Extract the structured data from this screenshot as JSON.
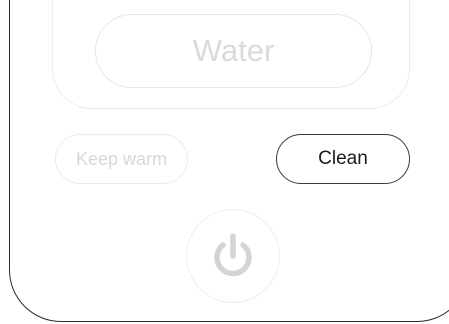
{
  "controls": {
    "water_label": "Water",
    "keep_warm_label": "Keep warm",
    "clean_label": "Clean"
  },
  "icons": {
    "power": "power-icon"
  },
  "colors": {
    "active_border": "#3a3a3a",
    "active_text": "#1a1a1a",
    "inactive_text": "#d8d8d8",
    "inactive_border": "#ebebeb",
    "power_icon": "#d4d4d4"
  }
}
